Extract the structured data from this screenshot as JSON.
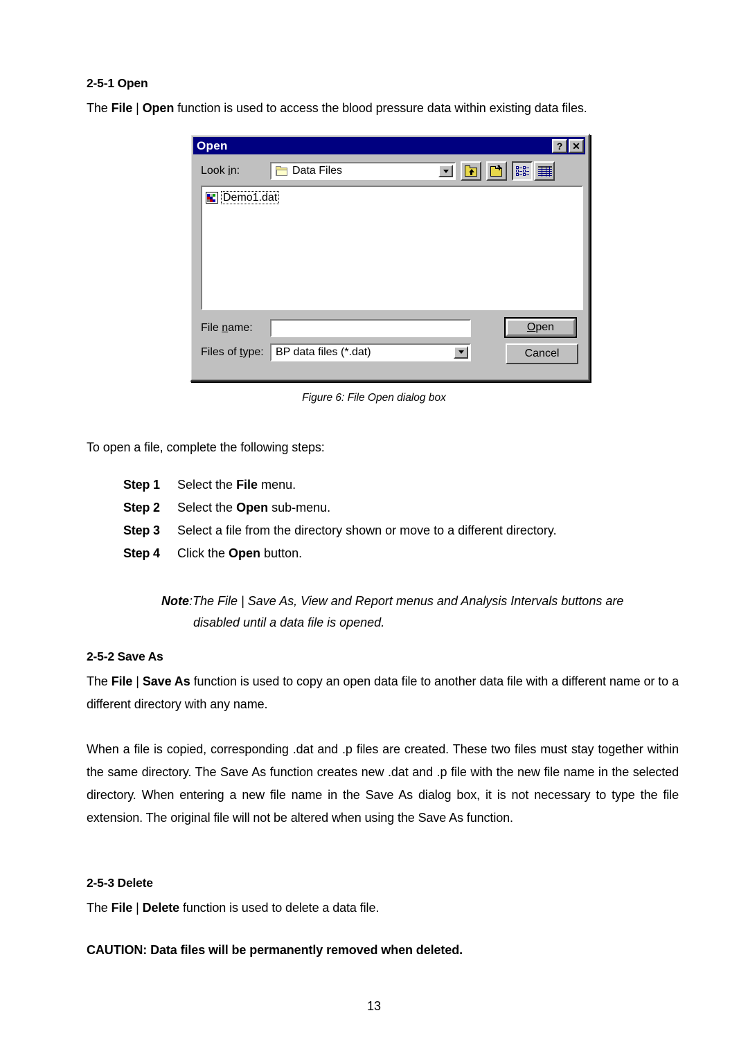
{
  "document": {
    "page_number": "13",
    "section_open": {
      "heading": "2-5-1 Open",
      "intro_pre": "The ",
      "intro_b1": "File",
      "intro_bar": " | ",
      "intro_b2": "Open",
      "intro_post": " function is used to access the blood pressure data within existing data files."
    },
    "figure": {
      "caption": "Figure 6:  File Open dialog box"
    },
    "steps_intro": "To open a file, complete the following steps:",
    "steps": [
      {
        "label": "Step 1",
        "pre": "Select the ",
        "bold": "File",
        "post": " menu."
      },
      {
        "label": "Step 2",
        "pre": "Select the ",
        "bold": "Open",
        "post": " sub-menu."
      },
      {
        "label": "Step 3",
        "pre": "Select a file from the directory shown or move to a different directory.",
        "bold": "",
        "post": ""
      },
      {
        "label": "Step 4",
        "pre": "Click the ",
        "bold": "Open",
        "post": " button."
      }
    ],
    "note": {
      "lead": "Note",
      "colon": ":",
      "line1": "The File | Save As, View and Report menus and Analysis Intervals buttons are",
      "line2": "disabled until a data file is opened."
    },
    "section_saveas": {
      "heading": "2-5-2 Save As",
      "p1_pre": "The ",
      "p1_b1": "File",
      "p1_bar": " | ",
      "p1_b2": "Save As",
      "p1_post": " function is used to copy an open data file to another data file with a different name or to a different directory with any name.",
      "p2": "When a file is copied, corresponding .dat and .p files are created. These two files must stay together within the same directory. The Save As function creates new .dat and .p file with the new file name in the selected directory. When entering a new file name in the Save As dialog box, it is not necessary to type the file extension. The original file will not be altered when using the Save As function."
    },
    "section_delete": {
      "heading": "2-5-3 Delete",
      "p1_pre": "The ",
      "p1_b1": "File",
      "p1_bar": " | ",
      "p1_b2": "Delete",
      "p1_post": " function is used to delete a data file.",
      "caution": "CAUTION:  Data files will be permanently removed when deleted."
    }
  },
  "dialog": {
    "title": "Open",
    "titlebar_help": "?",
    "titlebar_close": "✕",
    "lookin_label_pre": "Look ",
    "lookin_label_u": "i",
    "lookin_label_post": "n:",
    "lookin_value": "Data Files",
    "toolbar": {
      "up_one_level": "Up One Level",
      "create_new_folder": "Create New Folder",
      "list_view": "List",
      "details_view": "Details"
    },
    "files": [
      {
        "name": "Demo1.dat",
        "selected": true
      }
    ],
    "filename_label_pre": "File ",
    "filename_label_u": "n",
    "filename_label_post": "ame:",
    "filename_value": "",
    "filetype_label_pre": "Files of ",
    "filetype_label_u": "t",
    "filetype_label_post": "ype:",
    "filetype_value": "BP data files (*.dat)",
    "open_button_u": "O",
    "open_button_rest": "pen",
    "cancel_button": "Cancel",
    "colors": {
      "titlebar": "#000080",
      "face": "#c0c0c0",
      "field": "#ffffff",
      "folder": "#e8d84a"
    }
  }
}
